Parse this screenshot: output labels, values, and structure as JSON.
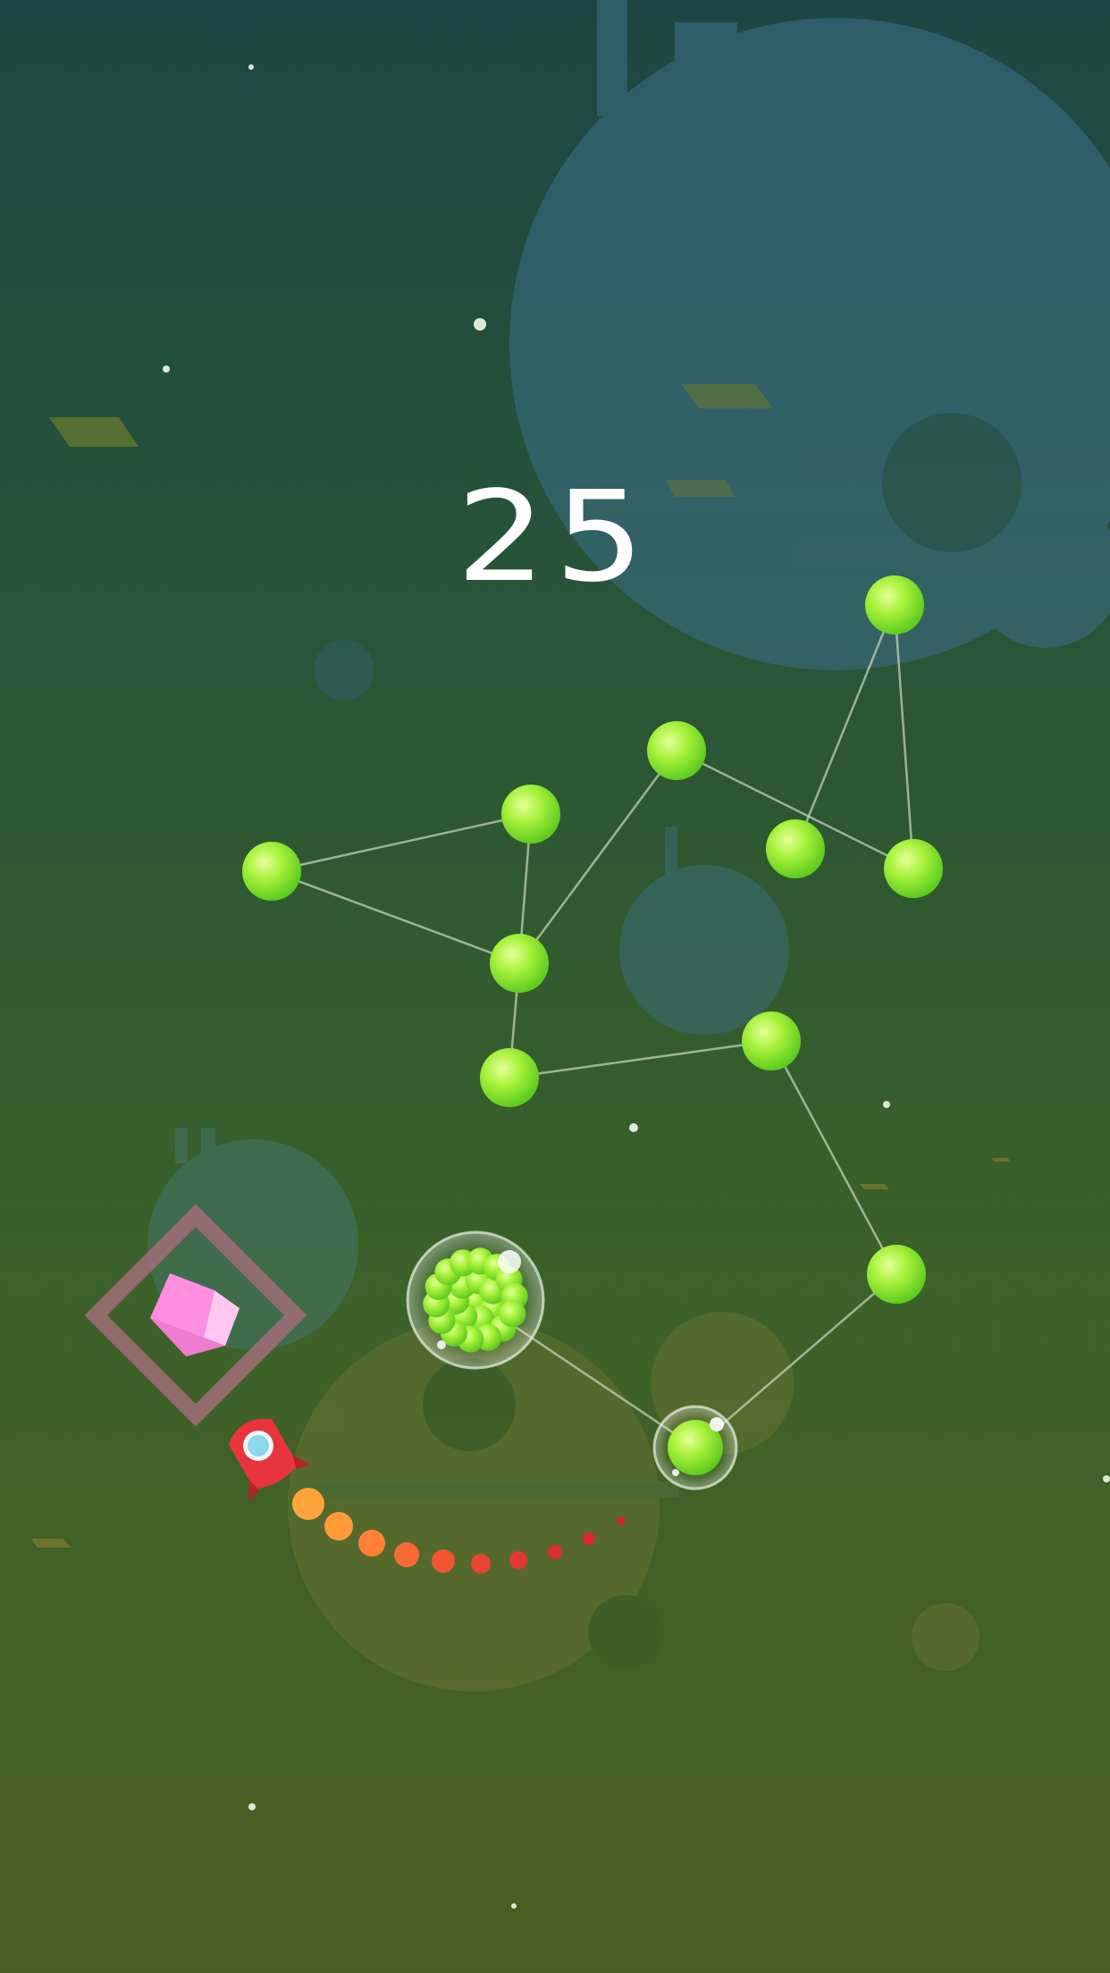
{
  "hud": {
    "score": "25"
  },
  "scene": {
    "colors": {
      "orb": "#a8f23c",
      "orb_dark": "#5fcc1f",
      "orb_highlight": "#e6ff9a",
      "link": "#c9dcc0",
      "ship": "#e8343c",
      "ship_window": "#8fd6f0",
      "gem": "#ff8ee0",
      "gem_frame": "#a16c78",
      "trail_near": "#ffa43a",
      "trail_far": "#d8282e",
      "planet": "#3d6e73"
    },
    "icons": {
      "player": "rocket-icon",
      "powerup": "pink-cube-icon",
      "bonus": "orb-cluster-icon",
      "target": "bubble-orb-icon"
    }
  }
}
